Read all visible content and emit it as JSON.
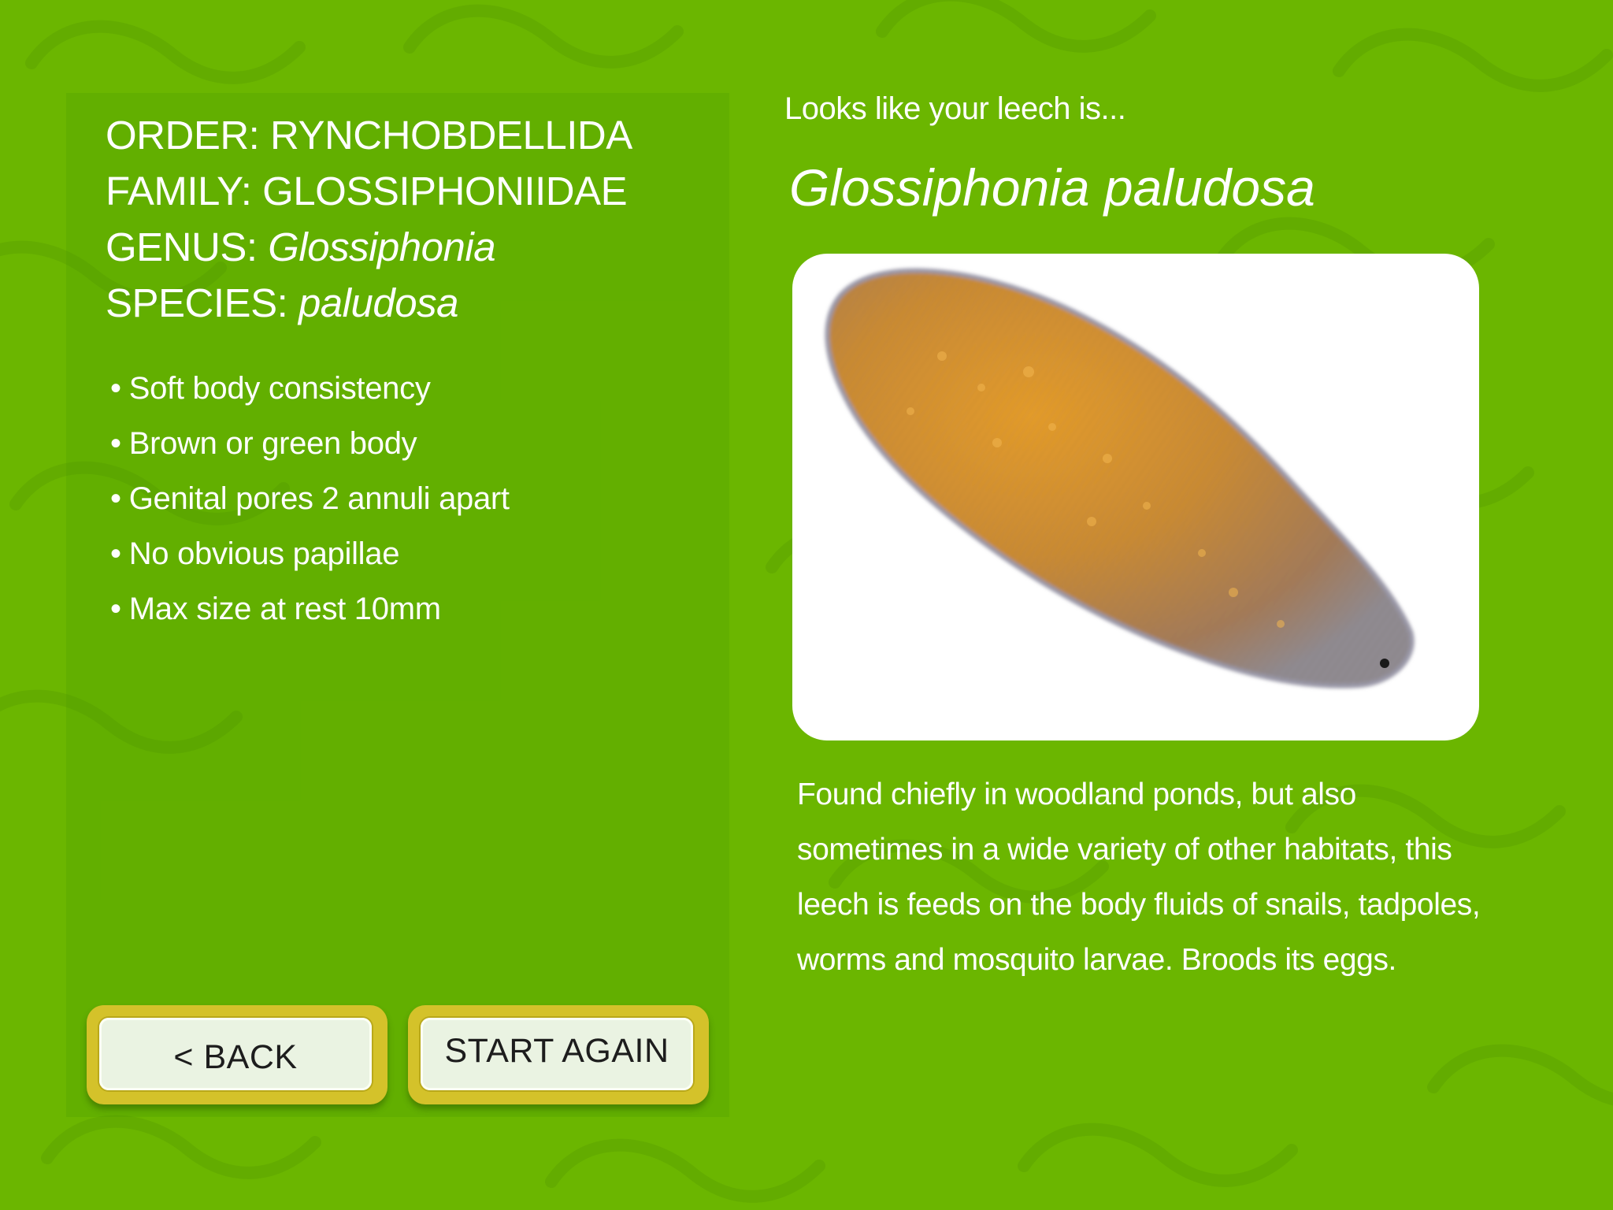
{
  "taxonomy": {
    "order_label": "ORDER:",
    "order_value": "RYNCHOBDELLIDA",
    "family_label": "FAMILY:",
    "family_value": "GLOSSIPHONIIDAE",
    "genus_label": "GENUS:",
    "genus_value": "Glossiphonia",
    "species_label": "SPECIES:",
    "species_value": "paludosa"
  },
  "features": [
    "Soft body consistency",
    "Brown or green body",
    "Genital pores 2 annuli apart",
    "No obvious papillae",
    "Max size at rest 10mm"
  ],
  "result": {
    "intro": "Looks like your leech is...",
    "species_name": "Glossiphonia paludosa",
    "description": "Found chiefly in woodland ponds, but also sometimes in a wide variety of other habitats, this leech is feeds on the body fluids of snails, tadpoles, worms and mosquito larvae. Broods its eggs."
  },
  "buttons": {
    "back_label": "< BACK",
    "start_again_label": "START AGAIN"
  },
  "colors": {
    "background": "#6bb600",
    "button_border": "#d4c22a",
    "button_face": "#eaf3e2",
    "text": "#ffffff"
  }
}
